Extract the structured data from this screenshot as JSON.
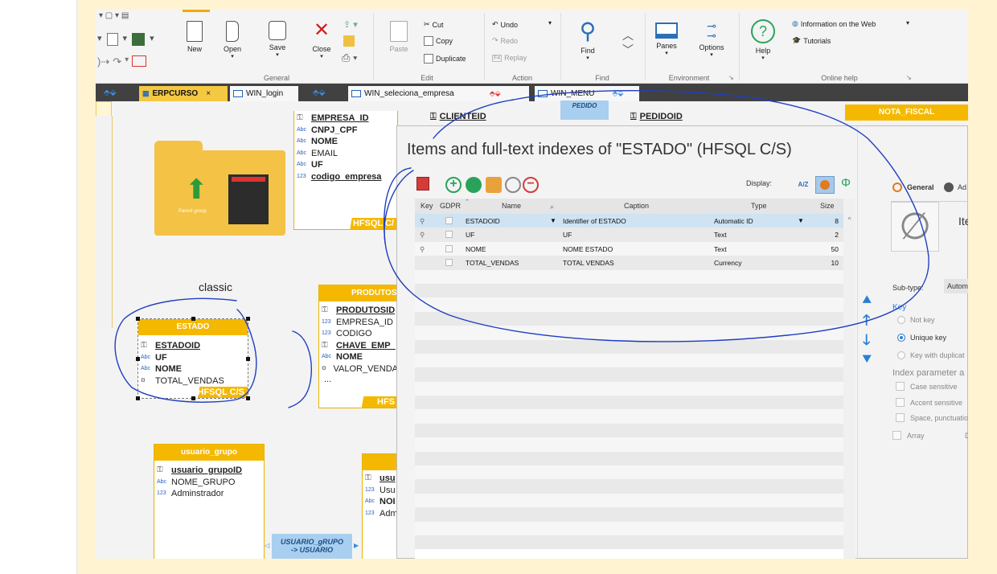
{
  "ribbon": {
    "new": "New",
    "open": "Open",
    "save": "Save",
    "close": "Close",
    "general_group": "General",
    "paste": "Paste",
    "cut": "Cut",
    "copy": "Copy",
    "duplicate": "Duplicate",
    "edit_group": "Edit",
    "undo": "Undo",
    "redo": "Redo",
    "replay": "Replay",
    "replay_key": "F4",
    "action_group": "Action",
    "find": "Find",
    "find_group": "Find",
    "panes": "Panes",
    "options": "Options",
    "environment_group": "Environment",
    "help": "Help",
    "info_web": "Information on the Web",
    "tutorials": "Tutorials",
    "online_help_group": "Online help"
  },
  "tabs": [
    {
      "label": "ERPCURSO",
      "close": "×"
    },
    {
      "label": "WIN_login"
    },
    {
      "label": "WIN_seleciona_empresa"
    },
    {
      "label": "WIN_MENU"
    }
  ],
  "diagram": {
    "parent_group_label": "Parent group",
    "classic_label": "classic",
    "pedido_link": "PEDIDO",
    "nota_fiscal": "NOTA_FISCAL",
    "empresa_fields": [
      {
        "type": "key",
        "name": "EMPRESA_ID"
      },
      {
        "type": "Abc",
        "name": "CNPJ_CPF"
      },
      {
        "type": "Abc",
        "name": "NOME"
      },
      {
        "type": "Abc",
        "name": "EMAIL"
      },
      {
        "type": "Abc",
        "name": "UF"
      },
      {
        "type": "123",
        "name": "codigo_empresa"
      }
    ],
    "empresa_footer": "HFSQL C/",
    "clienteid": "CLIENTEID",
    "pedidoid": "PEDIDOID",
    "produtos": {
      "title": "PRODUTOS",
      "fields": [
        {
          "type": "key",
          "name": "PRODUTOSID"
        },
        {
          "type": "123",
          "name": "EMPRESA_ID"
        },
        {
          "type": "123",
          "name": "CODIGO"
        },
        {
          "type": "key",
          "name": "CHAVE_EMP_"
        },
        {
          "type": "Abc",
          "name": "NOME"
        },
        {
          "type": "cur",
          "name": "VALOR_VENDA"
        }
      ],
      "more": "...",
      "footer": "HFS"
    },
    "estado": {
      "title": "ESTADO",
      "fields": [
        {
          "type": "key",
          "name": "ESTADOID"
        },
        {
          "type": "Abc",
          "name": "UF"
        },
        {
          "type": "Abc",
          "name": "NOME"
        },
        {
          "type": "cur",
          "name": "TOTAL_VENDAS"
        }
      ],
      "footer": "HFSQL C/S"
    },
    "usuario_grupo": {
      "title": "usuario_grupo",
      "fields": [
        {
          "type": "key",
          "name": "usuario_grupoID"
        },
        {
          "type": "Abc",
          "name": "NOME_GRUPO"
        },
        {
          "type": "123",
          "name": "Adminstrador"
        }
      ]
    },
    "usuario_partial": {
      "fields": [
        {
          "type": "key",
          "name": "usu"
        },
        {
          "type": "123",
          "name": "Usu"
        },
        {
          "type": "Abc",
          "name": "NOI"
        },
        {
          "type": "123",
          "name": "Adm"
        }
      ]
    },
    "link_label": "USUARIO_gRUPO\n-> USUARIO"
  },
  "dialog": {
    "title": "Items and full-text indexes of  \"ESTADO\" (HFSQL C/S)",
    "display_label": "Display:",
    "az_label": "A/Z",
    "columns": {
      "key": "Key",
      "gdpr": "GDPR",
      "name": "Name",
      "caption": "Caption",
      "type": "Type",
      "size": "Size"
    },
    "rows": [
      {
        "name": "ESTADOID",
        "caption": "Identifier of ESTADO",
        "type": "Automatic ID",
        "size": "8"
      },
      {
        "name": "UF",
        "caption": "UF",
        "type": "Text",
        "size": "2"
      },
      {
        "name": "NOME",
        "caption": "NOME ESTADO",
        "type": "Text",
        "size": "50"
      },
      {
        "name": "TOTAL_VENDAS",
        "caption": "TOTAL VENDAS",
        "type": "Currency",
        "size": "10"
      }
    ],
    "right": {
      "tab_general": "General",
      "tab_other": "Ad",
      "item_label": "Ite",
      "subtype_label": "Sub-type:",
      "subtype_value": "Autom",
      "key_section": "Key",
      "not_key": "Not key",
      "unique_key": "Unique key",
      "key_dup": "Key with duplicat",
      "index_params": "Index parameter a",
      "case_sensitive": "Case sensitive",
      "accent_sensitive": "Accent sensitive",
      "space_punct": "Space, punctuatio",
      "array": "Array",
      "array_d": "D"
    }
  },
  "colors": {
    "accent": "#f5b800",
    "highlight": "#cfe3f2",
    "annotation": "#1f3fc0"
  }
}
